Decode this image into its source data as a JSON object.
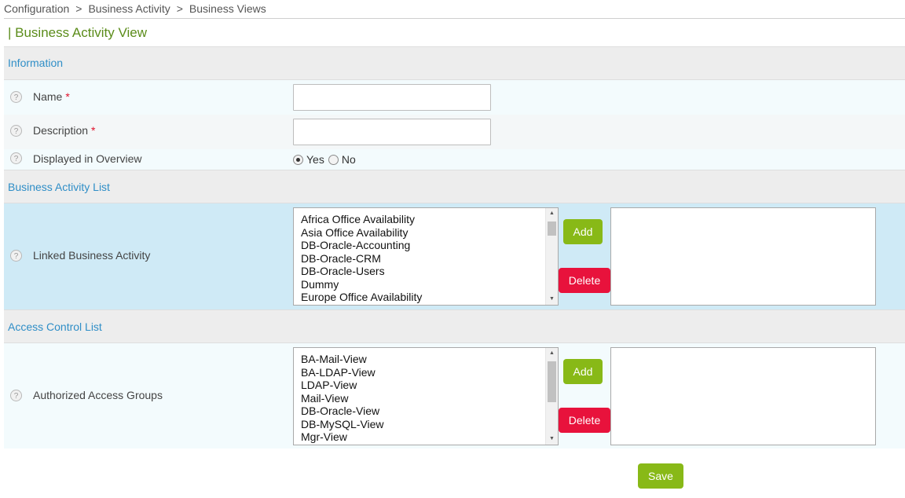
{
  "breadcrumb": {
    "items": [
      "Configuration",
      "Business Activity",
      "Business Views"
    ],
    "separator": ">"
  },
  "page": {
    "title": "| Business Activity View"
  },
  "sections": {
    "information": "Information",
    "business_activity_list": "Business Activity List",
    "access_control_list": "Access Control List"
  },
  "help_icon": "?",
  "required_mark": "*",
  "fields": {
    "name": {
      "label": "Name",
      "value": ""
    },
    "description": {
      "label": "Description",
      "value": ""
    },
    "displayed_in_overview": {
      "label": "Displayed in Overview",
      "options": [
        "Yes",
        "No"
      ],
      "selected": "Yes"
    },
    "linked_business_activity": {
      "label": "Linked Business Activity",
      "available": [
        "Africa Office Availability",
        "Asia Office Availability",
        "DB-Oracle-Accounting",
        "DB-Oracle-CRM",
        "DB-Oracle-Users",
        "Dummy",
        "Europe Office Availability"
      ],
      "selected": []
    },
    "authorized_access_groups": {
      "label": "Authorized Access Groups",
      "available": [
        "BA-Mail-View",
        "BA-LDAP-View",
        "LDAP-View",
        "Mail-View",
        "DB-Oracle-View",
        "DB-MySQL-View",
        "Mgr-View"
      ],
      "selected": []
    }
  },
  "buttons": {
    "add": "Add",
    "delete": "Delete",
    "save": "Save"
  },
  "colors": {
    "title": "#5b8c1a",
    "section": "#2f8ec7",
    "add": "#88b917",
    "delete": "#e8123c",
    "required": "#e0112b"
  }
}
